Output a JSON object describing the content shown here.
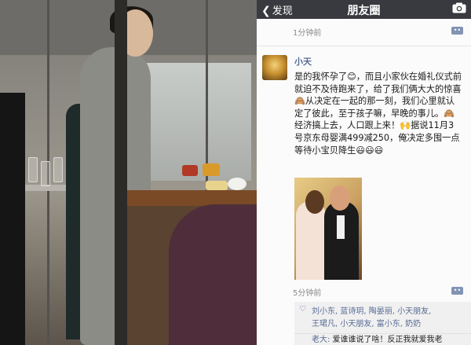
{
  "nav": {
    "back_label": "发现",
    "title": "朋友圈",
    "camera_icon": "camera-icon"
  },
  "top_entry": {
    "timestamp": "1分钟前"
  },
  "post": {
    "author": "小天",
    "text": "是的我怀孕了😊，而且小家伙在婚礼仪式前就迫不及待跑来了，给了我们俩大大的惊喜🙈从决定在一起的那一刻，我们心里就认定了彼此，至于孩子嘛，早晚的事儿。🙈经济搞上去，人口跟上来！🙌据说11月3号京东母婴满499减250，俺决定多囤一点等待小宝贝降生😃😃😃",
    "timestamp": "5分钟前",
    "likes_line1": "刘小东, 蓝诗玥, 陶晏丽, 小天朋友,",
    "likes_line2": "王珺凡, 小天朋友, 富小东, 奶奶",
    "comment_author": "老大:",
    "comment_text": " 爱谁谁说了啥！反正我就爱我老"
  },
  "colors": {
    "nav_bg": "#393a3f",
    "link": "#576b95",
    "timestamp": "#8a8a8a"
  }
}
